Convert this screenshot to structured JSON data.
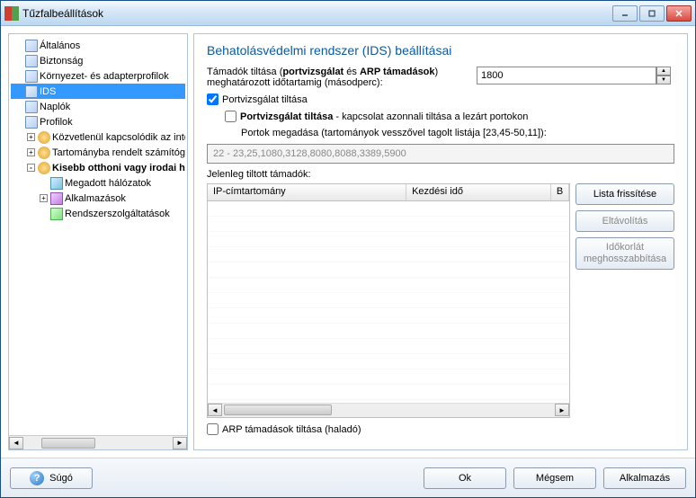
{
  "window": {
    "title": "Tűzfalbeállítások"
  },
  "tree": {
    "items": [
      {
        "label": "Általános",
        "depth": 1,
        "icon": "doc"
      },
      {
        "label": "Biztonság",
        "depth": 1,
        "icon": "doc"
      },
      {
        "label": "Környezet- és adapterprofilok",
        "depth": 1,
        "icon": "doc"
      },
      {
        "label": "IDS",
        "depth": 1,
        "icon": "doc",
        "selected": true
      },
      {
        "label": "Naplók",
        "depth": 1,
        "icon": "doc"
      },
      {
        "label": "Profilok",
        "depth": 1,
        "icon": "doc"
      },
      {
        "label": "Közvetlenül kapcsolódik az internethez",
        "depth": 2,
        "icon": "user",
        "expander": "+"
      },
      {
        "label": "Tartományba rendelt számítógép",
        "depth": 2,
        "icon": "user",
        "expander": "+"
      },
      {
        "label": "Kisebb otthoni vagy irodai hálózat",
        "depth": 2,
        "icon": "user",
        "expander": "-",
        "bold": true
      },
      {
        "label": "Megadott hálózatok",
        "depth": 3,
        "icon": "net"
      },
      {
        "label": "Alkalmazások",
        "depth": 3,
        "icon": "app",
        "expander": "+"
      },
      {
        "label": "Rendszerszolgáltatások",
        "depth": 3,
        "icon": "svc"
      }
    ]
  },
  "main": {
    "heading": "Behatolásvédelmi rendszer (IDS) beállításai",
    "timeout_prefix": "Támadók tiltása (",
    "timeout_bold1": "portvizsgálat",
    "timeout_mid": " és ",
    "timeout_bold2": "ARP támadások",
    "timeout_suffix": ") meghatározott időtartamig (másodperc):",
    "timeout_value": "1800",
    "cb_portscan": "Portvizsgálat tiltása",
    "cb_portscan_checked": true,
    "cb_portscan2_bold": "Portvizsgálat tiltása",
    "cb_portscan2_rest": " - kapcsolat azonnali tiltása a lezárt portokon",
    "ports_hint": "Portok megadása (tartományok vesszővel tagolt listája [23,45-50,11]):",
    "ports_value": "22 - 23,25,1080,3128,8080,8088,3389,5900",
    "blocked_label": "Jelenleg tiltott támadók:",
    "table": {
      "col1": "IP-címtartomány",
      "col2": "Kezdési idő",
      "col3": "B"
    },
    "cb_arp": "ARP támadások tiltása (haladó)",
    "cb_arp_checked": false
  },
  "buttons": {
    "refresh": "Lista frissítése",
    "remove": "Eltávolítás",
    "extend": "Időkorlát meghosszabbítása"
  },
  "footer": {
    "help": "Súgó",
    "ok": "Ok",
    "cancel": "Mégsem",
    "apply": "Alkalmazás"
  }
}
